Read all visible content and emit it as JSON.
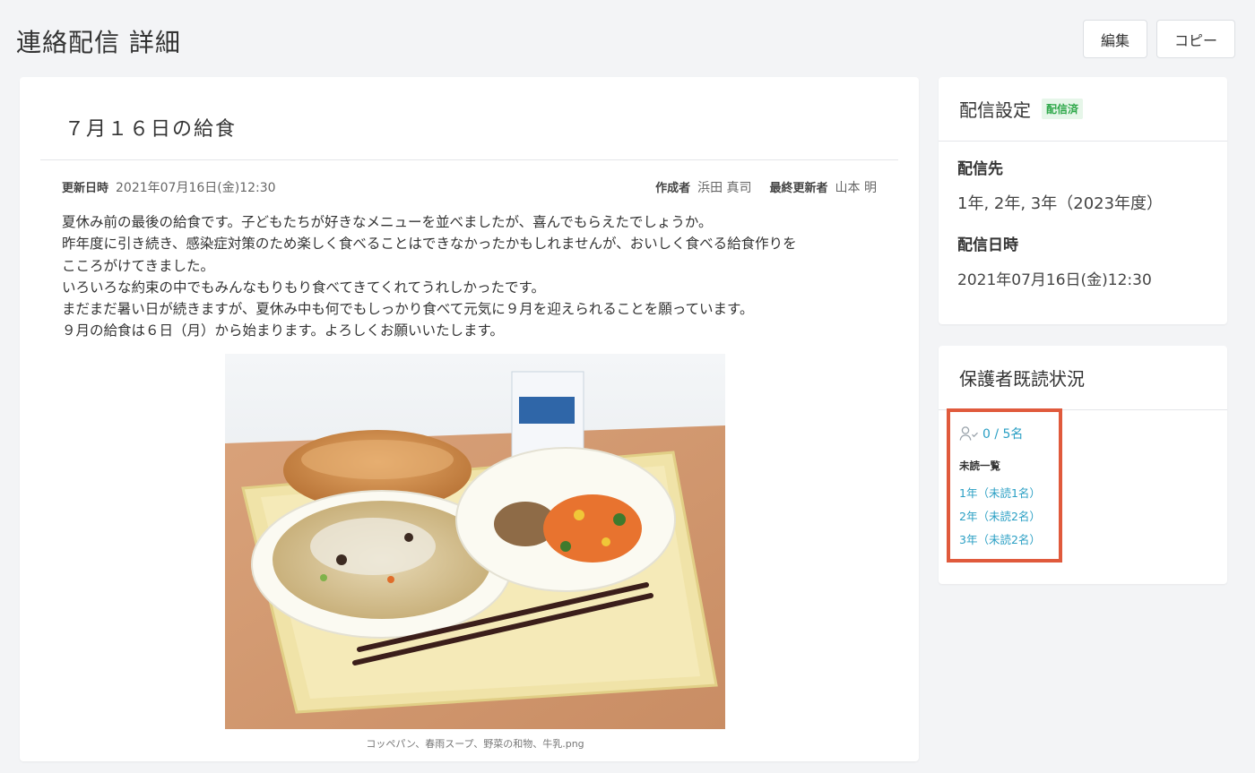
{
  "page": {
    "title": "連絡配信 詳細",
    "edit_label": "編集",
    "copy_label": "コピー"
  },
  "post": {
    "title": "７月１６日の給食",
    "updated_label": "更新日時",
    "updated_value": "2021年07月16日(金)12:30",
    "author_label": "作成者",
    "author_value": "浜田 真司",
    "last_editor_label": "最終更新者",
    "last_editor_value": "山本 明",
    "body": "夏休み前の最後の給食です。子どもたちが好きなメニューを並べましたが、喜んでもらえたでしょうか。\n昨年度に引き続き、感染症対策のため楽しく食べることはできなかったかもしれませんが、おいしく食べる給食作りを\nこころがけてきました。\nいろいろな約束の中でもみんなもりもり食べてきてくれてうれしかったです。\nまだまだ暑い日が続きますが、夏休み中も何でもしっかり食べて元気に９月を迎えられることを願っています。\n９月の給食は６日（月）から始まります。よろしくお願いいたします。",
    "image_caption": "コッペパン、春雨スープ、野菜の和物、牛乳.png"
  },
  "settings": {
    "title": "配信設定",
    "badge": "配信済",
    "badge_color": "#2fa84a",
    "target_label": "配信先",
    "target_value": "1年, 2年, 3年（2023年度）",
    "date_label": "配信日時",
    "date_value": "2021年07月16日(金)12:30"
  },
  "read_status": {
    "title": "保護者既読状況",
    "count": "0 / 5名",
    "unread_title": "未読一覧",
    "unread_items": [
      "1年（未読1名）",
      "2年（未読2名）",
      "3年（未読2名）"
    ],
    "link_color": "#2a9fc4",
    "highlight_color": "#e05a3c"
  },
  "icons": {
    "read_count": "user-check-icon"
  }
}
